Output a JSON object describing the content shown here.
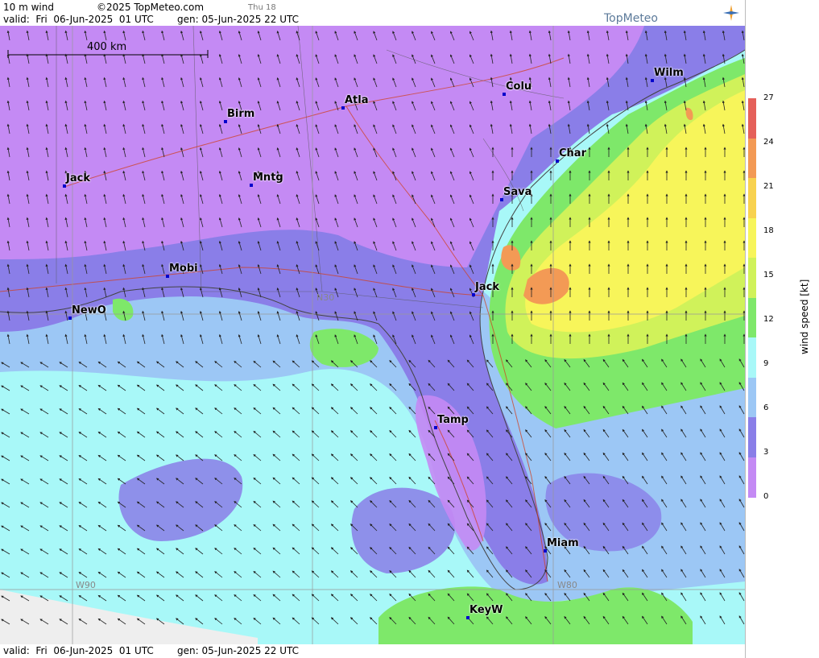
{
  "header": {
    "parameter": "10 m wind",
    "copyright": "©2025 TopMeteo.com",
    "day_label": "Thu 18",
    "valid": "valid:  Fri  06-Jun-2025  01 UTC",
    "generated": "gen: 05-Jun-2025 22 UTC",
    "brand": "TopMeteo"
  },
  "footer": {
    "valid": "valid:  Fri  06-Jun-2025  01 UTC",
    "generated": "gen: 05-Jun-2025 22 UTC"
  },
  "scale_bar": {
    "label": "400 km"
  },
  "grid_labels": {
    "n30": "N30",
    "w90": "W90",
    "w80": "W80"
  },
  "legend": {
    "title": "wind speed [kt]",
    "ticks": [
      "27",
      "24",
      "21",
      "18",
      "15",
      "12",
      "9",
      "6",
      "3",
      "0"
    ],
    "colors": [
      "#e5605a",
      "#f39a55",
      "#f8d24f",
      "#f7f55a",
      "#d0f25a",
      "#7ee86a",
      "#a8f8f8",
      "#9cc7f5",
      "#8a7ee8",
      "#c48af4"
    ]
  },
  "cities": [
    {
      "name": "Wilm"
    },
    {
      "name": "Colu"
    },
    {
      "name": "Atla"
    },
    {
      "name": "Birm"
    },
    {
      "name": "Char"
    },
    {
      "name": "Sava"
    },
    {
      "name": "Jack"
    },
    {
      "name": "Mntg"
    },
    {
      "name": "Mobi"
    },
    {
      "name": "Jack"
    },
    {
      "name": "NewO"
    },
    {
      "name": "Tamp"
    },
    {
      "name": "Miam"
    },
    {
      "name": "KeyW"
    }
  ],
  "colors": {
    "calm": "#c48af4",
    "light": "#8a7ee8",
    "sea": "#a8f8f8",
    "moderate": "#9cc7f5",
    "fresh": "#7ee86a",
    "strong": "#f7f55a",
    "gale": "#f39a55"
  }
}
